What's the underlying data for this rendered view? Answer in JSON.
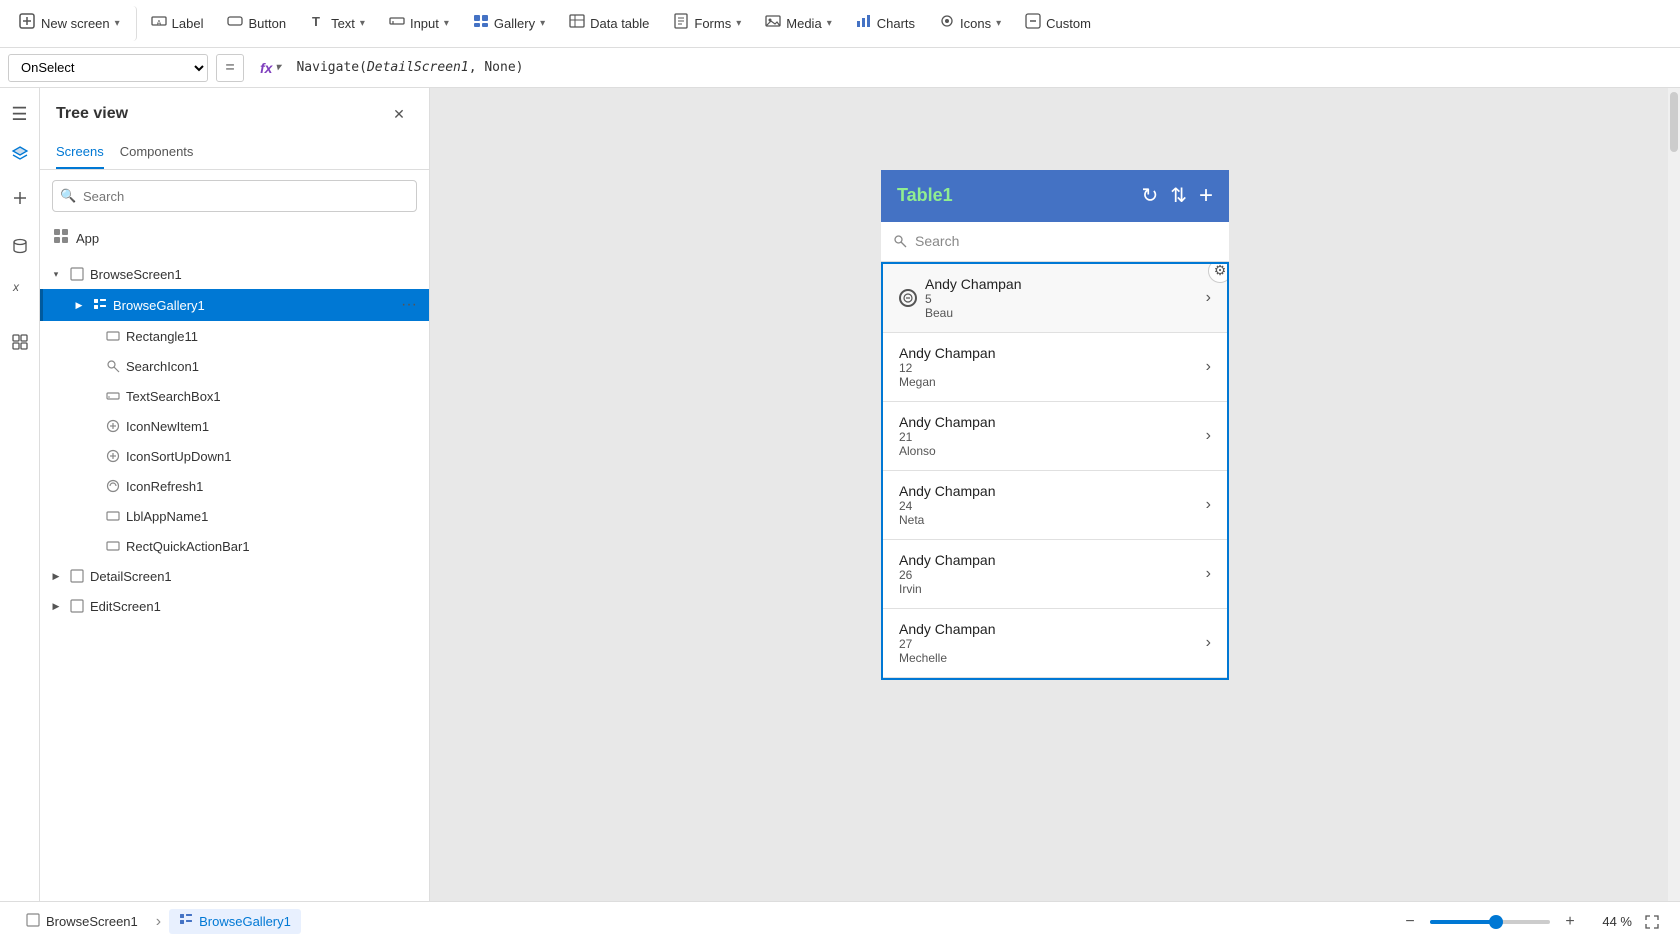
{
  "toolbar": {
    "new_screen_label": "New screen",
    "label_label": "Label",
    "button_label": "Button",
    "text_label": "Text",
    "input_label": "Input",
    "gallery_label": "Gallery",
    "data_table_label": "Data table",
    "forms_label": "Forms",
    "media_label": "Media",
    "charts_label": "Charts",
    "icons_label": "Icons",
    "custom_label": "Custom"
  },
  "formula_bar": {
    "property": "OnSelect",
    "fx_label": "fx",
    "formula": "Navigate(DetailScreen1, None)"
  },
  "tree_view": {
    "title": "Tree view",
    "tabs": [
      "Screens",
      "Components"
    ],
    "active_tab": "Screens",
    "search_placeholder": "Search",
    "items": [
      {
        "id": "browse-screen",
        "label": "BrowseScreen1",
        "indent": 0,
        "expanded": true,
        "type": "screen"
      },
      {
        "id": "browse-gallery",
        "label": "BrowseGallery1",
        "indent": 1,
        "expanded": false,
        "type": "gallery",
        "selected": true,
        "has_more": true
      },
      {
        "id": "rectangle11",
        "label": "Rectangle11",
        "indent": 2,
        "type": "rectangle"
      },
      {
        "id": "search-icon1",
        "label": "SearchIcon1",
        "indent": 2,
        "type": "icon"
      },
      {
        "id": "text-search-box1",
        "label": "TextSearchBox1",
        "indent": 2,
        "type": "input"
      },
      {
        "id": "icon-new-item1",
        "label": "IconNewItem1",
        "indent": 2,
        "type": "icon"
      },
      {
        "id": "icon-sort-up-down1",
        "label": "IconSortUpDown1",
        "indent": 2,
        "type": "icon"
      },
      {
        "id": "icon-refresh1",
        "label": "IconRefresh1",
        "indent": 2,
        "type": "icon"
      },
      {
        "id": "lbl-app-name1",
        "label": "LblAppName1",
        "indent": 2,
        "type": "label"
      },
      {
        "id": "rect-quick-action-bar1",
        "label": "RectQuickActionBar1",
        "indent": 2,
        "type": "rectangle"
      },
      {
        "id": "detail-screen1",
        "label": "DetailScreen1",
        "indent": 0,
        "expanded": false,
        "type": "screen"
      },
      {
        "id": "edit-screen1",
        "label": "EditScreen1",
        "indent": 0,
        "expanded": false,
        "type": "screen"
      }
    ]
  },
  "app_item": {
    "label": "App"
  },
  "canvas": {
    "table_title": "Table1",
    "search_placeholder": "Search",
    "gallery_items": [
      {
        "name": "Andy Champan",
        "number": "5",
        "sub": "Beau"
      },
      {
        "name": "Andy Champan",
        "number": "12",
        "sub": "Megan"
      },
      {
        "name": "Andy Champan",
        "number": "21",
        "sub": "Alonso"
      },
      {
        "name": "Andy Champan",
        "number": "24",
        "sub": "Neta"
      },
      {
        "name": "Andy Champan",
        "number": "26",
        "sub": "Irvin"
      },
      {
        "name": "Andy Champan",
        "number": "27",
        "sub": "Mechelle"
      }
    ]
  },
  "status_bar": {
    "breadcrumb1": "BrowseScreen1",
    "breadcrumb2": "BrowseGallery1",
    "zoom_percent": "44 %"
  }
}
